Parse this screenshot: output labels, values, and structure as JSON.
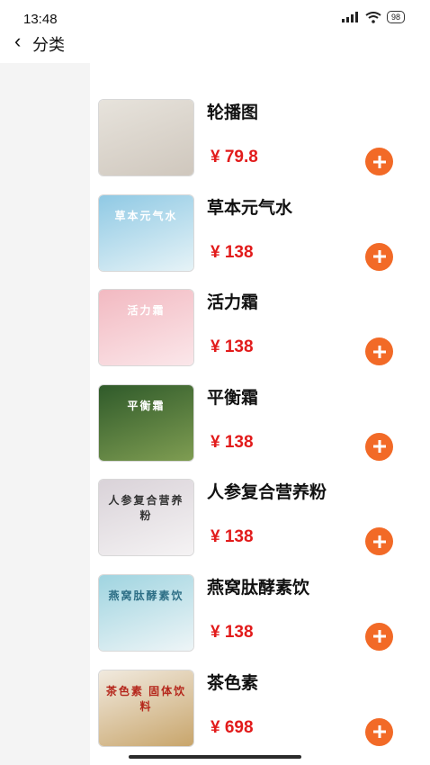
{
  "status": {
    "time": "13:48",
    "battery": "98"
  },
  "nav": {
    "title": "分类"
  },
  "products": [
    {
      "name": "轮播图",
      "price": "¥ 79.8",
      "thumb_text": "",
      "thumb_colors": [
        "#e7e3dc",
        "#cfc7bd"
      ]
    },
    {
      "name": "草本元气水",
      "price": "¥ 138",
      "thumb_text": "草本元气水",
      "thumb_colors": [
        "#8fc9e4",
        "#e6f3f7"
      ]
    },
    {
      "name": "活力霜",
      "price": "¥ 138",
      "thumb_text": "活力霜",
      "thumb_colors": [
        "#f2b9c1",
        "#fbe7ea"
      ]
    },
    {
      "name": "平衡霜",
      "price": "¥ 138",
      "thumb_text": "平衡霜",
      "thumb_colors": [
        "#2f5a2a",
        "#7f9d52"
      ]
    },
    {
      "name": "人参复合营养粉",
      "price": "¥ 138",
      "thumb_text": "人参复合营养粉",
      "thumb_colors": [
        "#d9d2d8",
        "#f5f3f4"
      ]
    },
    {
      "name": "燕窝肽酵素饮",
      "price": "¥ 138",
      "thumb_text": "燕窝肽酵素饮",
      "thumb_colors": [
        "#9fd4e0",
        "#eef5f7"
      ]
    },
    {
      "name": "茶色素",
      "price": "¥ 698",
      "thumb_text": "茶色素 固体饮料",
      "thumb_colors": [
        "#f1eadf",
        "#c8a56b"
      ]
    }
  ],
  "colors": {
    "accent": "#f26a27",
    "price": "#e21b1b",
    "sidebar": "#f4f4f4"
  }
}
